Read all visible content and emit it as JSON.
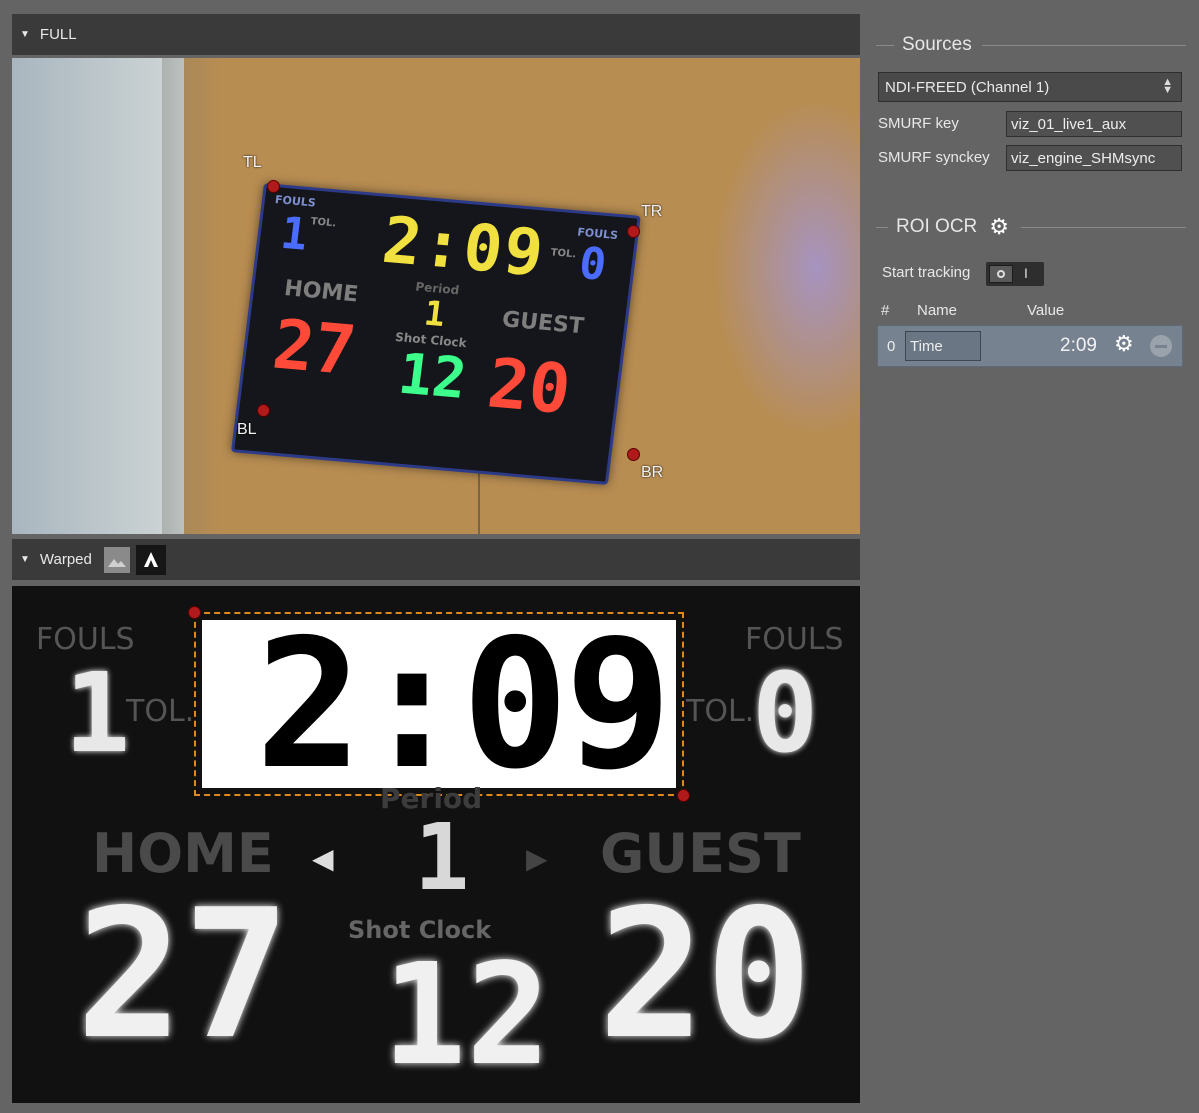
{
  "full_panel": {
    "title": "FULL",
    "corners": {
      "tl": "TL",
      "tr": "TR",
      "bl": "BL",
      "br": "BR"
    },
    "scoreboard": {
      "fouls_label": "FOULS",
      "tol_label": "TOL.",
      "home_fouls": "1",
      "guest_fouls": "0",
      "time": "2:09",
      "period_label": "Period",
      "period": "1",
      "home_label": "HOME",
      "guest_label": "GUEST",
      "shot_clock_label": "Shot Clock",
      "shot_clock": "12",
      "home_score": "27",
      "guest_score": "20"
    }
  },
  "warped_panel": {
    "title": "Warped",
    "icon_image": "image-icon",
    "icon_text": "text-a-icon",
    "scoreboard": {
      "fouls_left": "FOULS",
      "fouls_right": "FOULS",
      "tol_left": "TOL.",
      "tol_right": "TOL.",
      "home_fouls": "1",
      "guest_fouls": "0",
      "roi_time": "2:09",
      "period_label": "Period",
      "period": "1",
      "home_label": "HOME",
      "guest_label": "GUEST",
      "shot_clock_label": "Shot Clock",
      "shot_clock": "12",
      "home_score": "27",
      "guest_score": "20"
    }
  },
  "sources": {
    "title": "Sources",
    "selected_source": "NDI-FREED (Channel 1)",
    "smurf_key_label": "SMURF key",
    "smurf_key_value": "viz_01_live1_aux",
    "smurf_synckey_label": "SMURF synckey",
    "smurf_synckey_value": "viz_engine_SHMsync"
  },
  "roi_ocr": {
    "title": "ROI OCR",
    "start_tracking_label": "Start tracking",
    "toggle_on_glyph": "I",
    "columns": {
      "index": "#",
      "name": "Name",
      "value": "Value"
    },
    "rows": [
      {
        "index": "0",
        "name": "Time",
        "value": "2:09"
      }
    ]
  },
  "colors": {
    "background": "#646464",
    "header": "#3a3a3a",
    "roi_row": "#76828f",
    "roi_box": "#e08a1e",
    "led_yellow": "#f0e040",
    "led_red": "#ff4a3a",
    "led_green": "#3cff8c",
    "led_blue": "#3a5cff"
  }
}
